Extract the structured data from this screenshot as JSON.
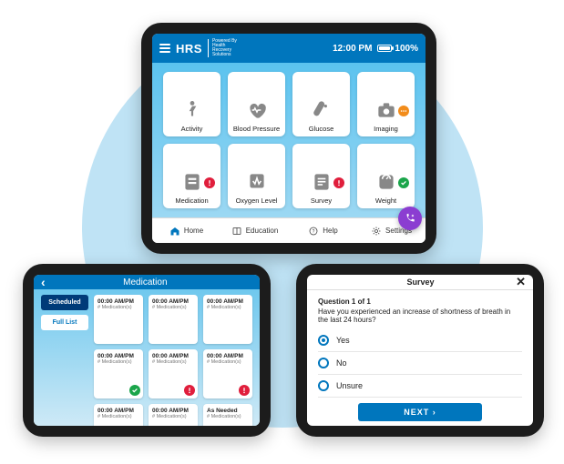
{
  "home": {
    "brand": "HRS",
    "brand_sub": "Powered By\nHealth\nRecovery\nSolutions",
    "time": "12:00 PM",
    "battery_pct": "100%",
    "tiles": [
      {
        "label": "Activity",
        "icon": "activity",
        "badge": null
      },
      {
        "label": "Blood Pressure",
        "icon": "heart-ecg",
        "badge": null
      },
      {
        "label": "Glucose",
        "icon": "glucose",
        "badge": null
      },
      {
        "label": "Imaging",
        "icon": "camera",
        "badge": "orange"
      },
      {
        "label": "Medication",
        "icon": "medication",
        "badge": "red"
      },
      {
        "label": "Oxygen Level",
        "icon": "oxygen",
        "badge": null
      },
      {
        "label": "Survey",
        "icon": "survey",
        "badge": "red"
      },
      {
        "label": "Weight",
        "icon": "weight",
        "badge": "green"
      }
    ],
    "nav": [
      {
        "label": "Home",
        "icon": "home"
      },
      {
        "label": "Education",
        "icon": "book"
      },
      {
        "label": "Help",
        "icon": "help"
      },
      {
        "label": "Settings",
        "icon": "gear"
      }
    ]
  },
  "medication": {
    "title": "Medication",
    "tabs": [
      {
        "label": "Scheduled",
        "active": true
      },
      {
        "label": "Full List",
        "active": false
      }
    ],
    "card_time_label": "00:00 AM/PM",
    "card_sub_label": "# Medication(s)",
    "as_needed_label": "As Needed",
    "cards": [
      {
        "badge": null
      },
      {
        "badge": null
      },
      {
        "badge": null
      },
      {
        "badge": "green"
      },
      {
        "badge": "red"
      },
      {
        "badge": "red"
      },
      {
        "badge": null
      },
      {
        "badge": null
      },
      {
        "as_needed": true,
        "badge": null
      }
    ]
  },
  "survey": {
    "title": "Survey",
    "question_number": "Question 1 of 1",
    "question_text": "Have you experienced an increase of shortness of breath in the last 24 hours?",
    "options": [
      {
        "label": "Yes",
        "selected": true
      },
      {
        "label": "No",
        "selected": false
      },
      {
        "label": "Unsure",
        "selected": false
      }
    ],
    "next_label": "NEXT"
  }
}
